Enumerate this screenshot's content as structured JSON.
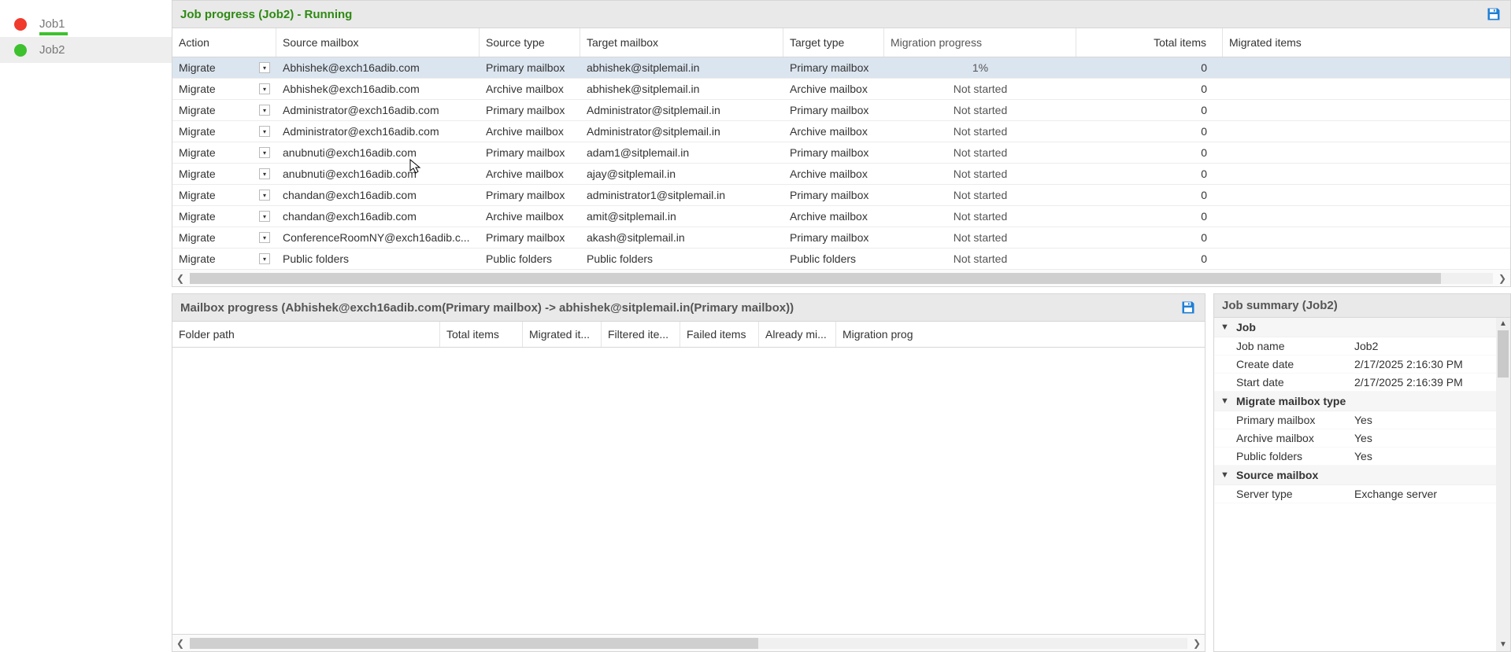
{
  "sidebar": {
    "jobs": [
      {
        "label": "Job1"
      },
      {
        "label": "Job2"
      }
    ]
  },
  "jobProgress": {
    "title": "Job progress (Job2) - Running",
    "columns": {
      "action": "Action",
      "source": "Source mailbox",
      "stype": "Source type",
      "target": "Target mailbox",
      "ttype": "Target type",
      "prog": "Migration progress",
      "total": "Total items",
      "mig": "Migrated items"
    },
    "actionLabel": "Migrate",
    "rows": [
      {
        "source": "Abhishek@exch16adib.com",
        "stype": "Primary mailbox",
        "target": "abhishek@sitplemail.in",
        "ttype": "Primary mailbox",
        "prog": "1%",
        "total": "0",
        "mig": "",
        "selected": true
      },
      {
        "source": "Abhishek@exch16adib.com",
        "stype": "Archive mailbox",
        "target": "abhishek@sitplemail.in",
        "ttype": "Archive mailbox",
        "prog": "Not started",
        "total": "0",
        "mig": ""
      },
      {
        "source": "Administrator@exch16adib.com",
        "stype": "Primary mailbox",
        "target": "Administrator@sitplemail.in",
        "ttype": "Primary mailbox",
        "prog": "Not started",
        "total": "0",
        "mig": ""
      },
      {
        "source": "Administrator@exch16adib.com",
        "stype": "Archive mailbox",
        "target": "Administrator@sitplemail.in",
        "ttype": "Archive mailbox",
        "prog": "Not started",
        "total": "0",
        "mig": ""
      },
      {
        "source": "anubnuti@exch16adib.com",
        "stype": "Primary mailbox",
        "target": "adam1@sitplemail.in",
        "ttype": "Primary mailbox",
        "prog": "Not started",
        "total": "0",
        "mig": ""
      },
      {
        "source": "anubnuti@exch16adib.com",
        "stype": "Archive mailbox",
        "target": "ajay@sitplemail.in",
        "ttype": "Archive mailbox",
        "prog": "Not started",
        "total": "0",
        "mig": ""
      },
      {
        "source": "chandan@exch16adib.com",
        "stype": "Primary mailbox",
        "target": "administrator1@sitplemail.in",
        "ttype": "Primary mailbox",
        "prog": "Not started",
        "total": "0",
        "mig": ""
      },
      {
        "source": "chandan@exch16adib.com",
        "stype": "Archive mailbox",
        "target": "amit@sitplemail.in",
        "ttype": "Archive mailbox",
        "prog": "Not started",
        "total": "0",
        "mig": ""
      },
      {
        "source": "ConferenceRoomNY@exch16adib.c...",
        "stype": "Primary mailbox",
        "target": "akash@sitplemail.in",
        "ttype": "Primary mailbox",
        "prog": "Not started",
        "total": "0",
        "mig": ""
      },
      {
        "source": "Public folders",
        "stype": "Public folders",
        "target": "Public folders",
        "ttype": "Public folders",
        "prog": "Not started",
        "total": "0",
        "mig": ""
      }
    ]
  },
  "mailboxProgress": {
    "title": "Mailbox progress (Abhishek@exch16adib.com(Primary mailbox) -> abhishek@sitplemail.in(Primary mailbox))",
    "columns": {
      "folder": "Folder path",
      "total": "Total items",
      "migrated": "Migrated it...",
      "filtered": "Filtered ite...",
      "failed": "Failed items",
      "already": "Already mi...",
      "prog": "Migration prog"
    }
  },
  "jobSummary": {
    "title": "Job summary (Job2)",
    "groups": [
      {
        "name": "Job",
        "rows": [
          {
            "k": "Job name",
            "v": "Job2"
          },
          {
            "k": "Create date",
            "v": "2/17/2025 2:16:30 PM"
          },
          {
            "k": "Start date",
            "v": "2/17/2025 2:16:39 PM"
          }
        ]
      },
      {
        "name": "Migrate mailbox type",
        "rows": [
          {
            "k": "Primary mailbox",
            "v": "Yes"
          },
          {
            "k": "Archive mailbox",
            "v": "Yes"
          },
          {
            "k": "Public folders",
            "v": "Yes"
          }
        ]
      },
      {
        "name": "Source mailbox",
        "rows": [
          {
            "k": "Server type",
            "v": "Exchange server"
          }
        ]
      }
    ]
  }
}
